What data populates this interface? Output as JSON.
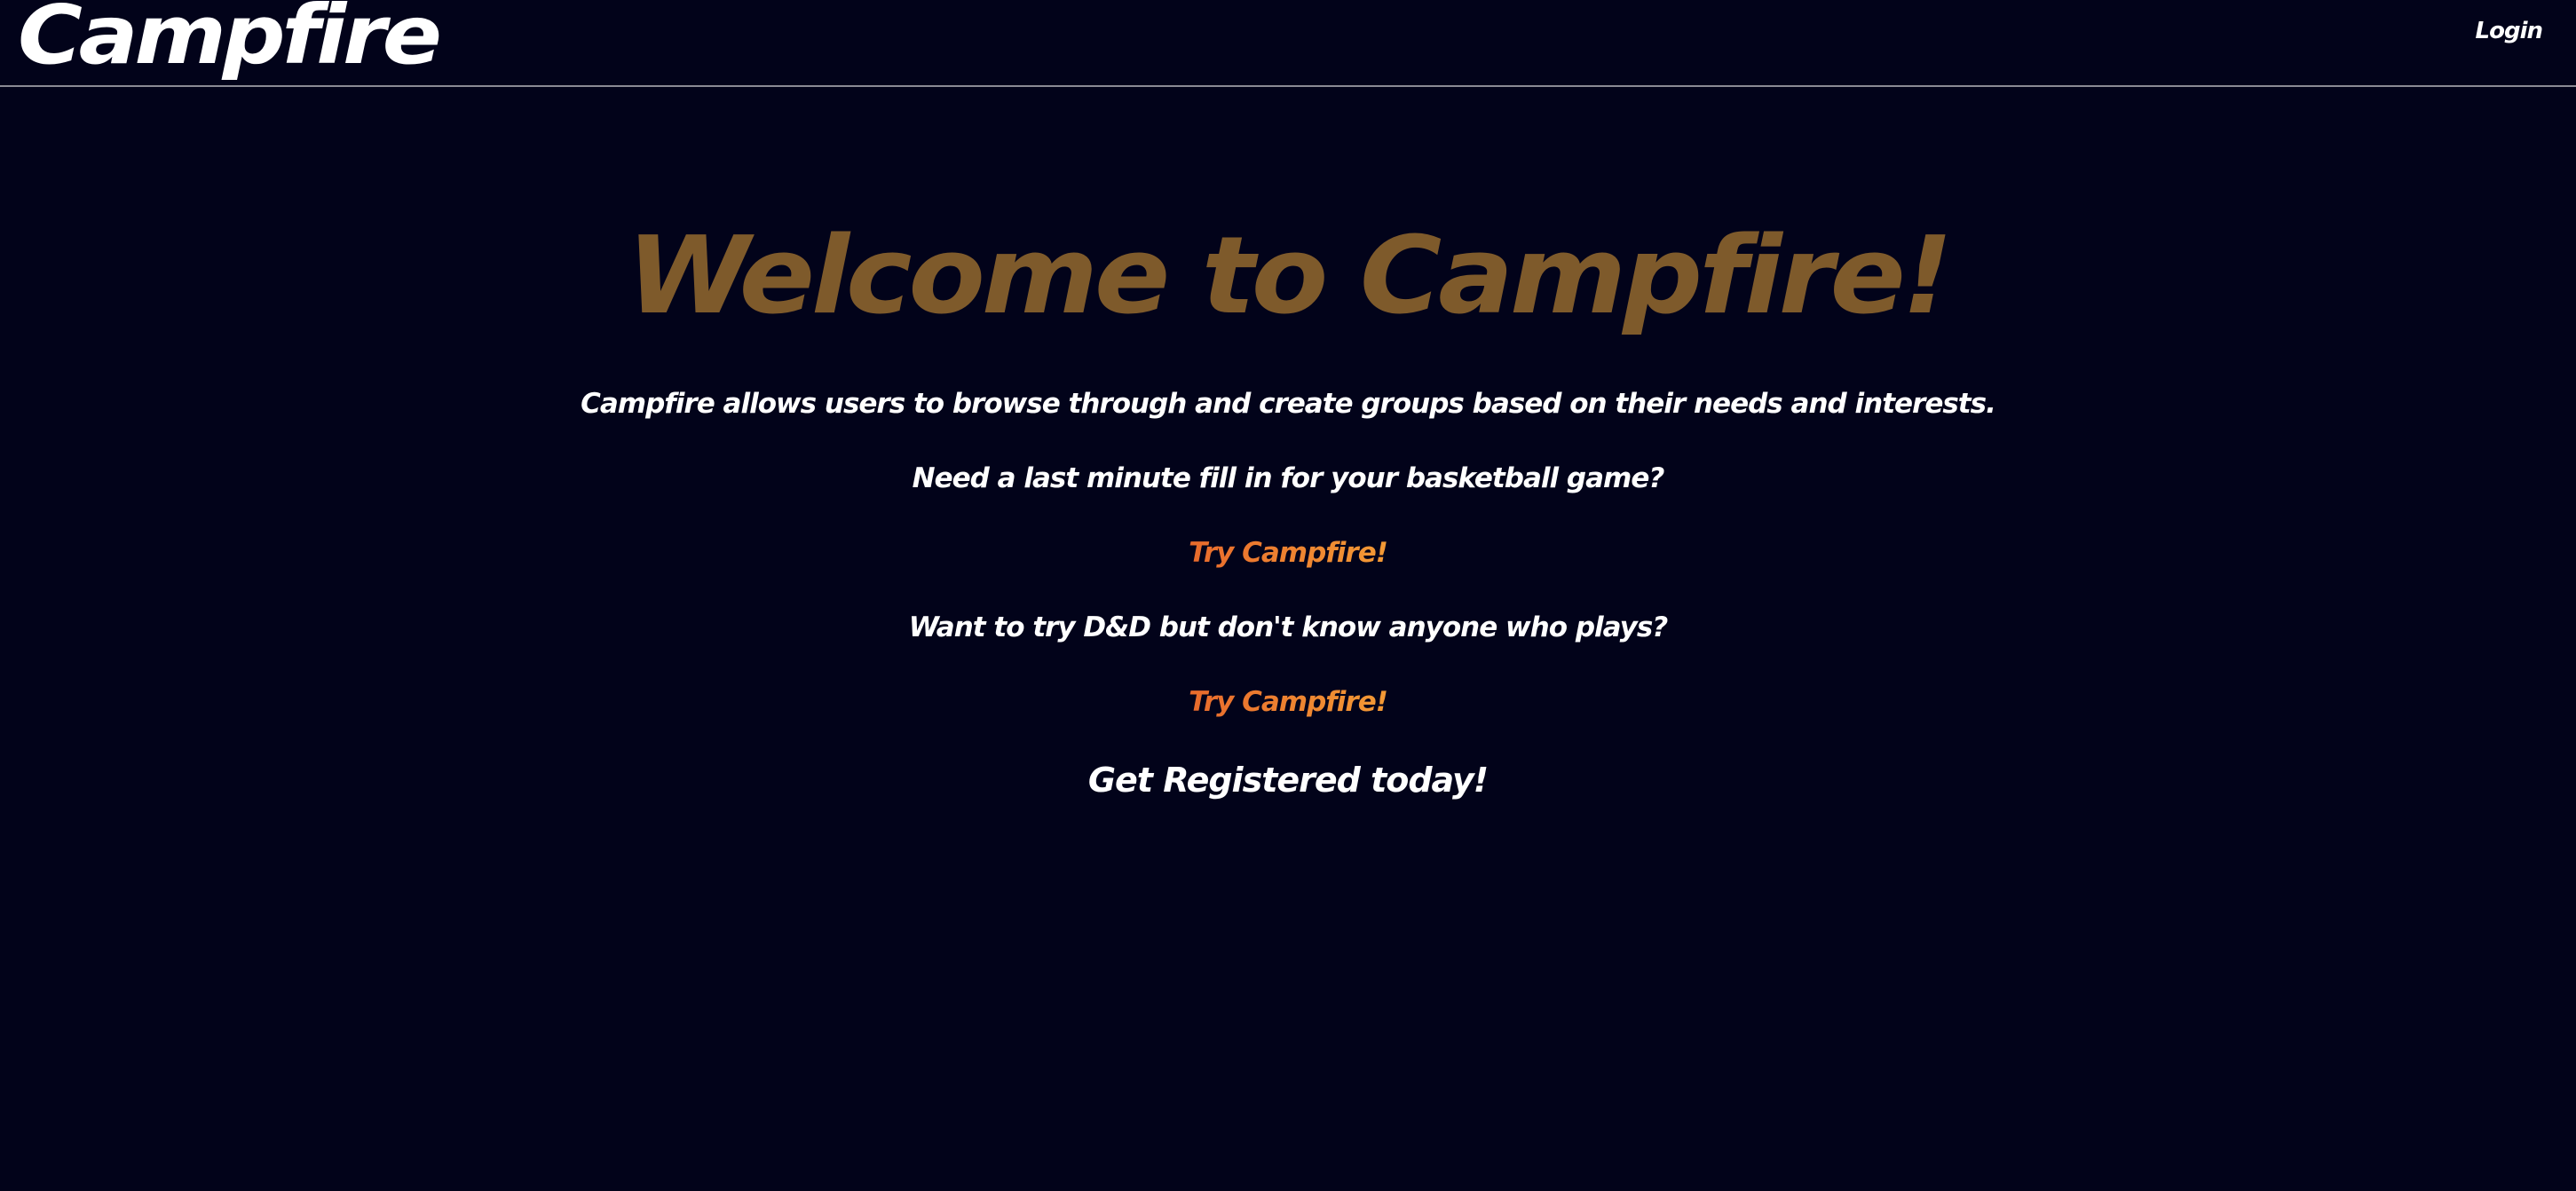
{
  "navbar": {
    "brand": "Campfire",
    "login_label": "Login"
  },
  "hero": {
    "title": "Welcome to Campfire!",
    "intro": "Campfire allows users to browse through and create groups based on their needs and interests.",
    "question_1": "Need a last minute fill in for your basketball game?",
    "cta_1": "Try Campfire!",
    "question_2": "Want to try D&D but don't know anyone who plays?",
    "cta_2": "Try Campfire!",
    "register": "Get Registered today!"
  },
  "colors": {
    "background": "#02031a",
    "title": "#7e5a2b",
    "cta_start": "#e86a2c",
    "cta_end": "#f39a35",
    "text": "#ffffff"
  }
}
